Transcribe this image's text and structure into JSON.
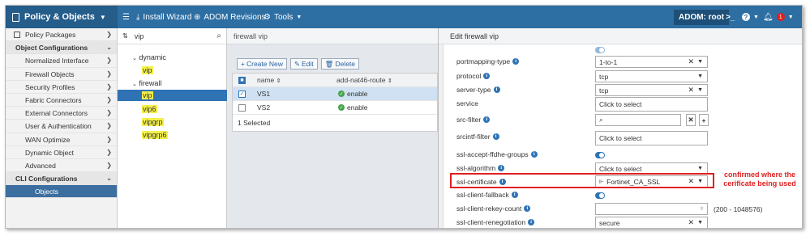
{
  "topbar": {
    "brand": "Policy & Objects",
    "install_wizard": "Install Wizard",
    "adom_revisions": "ADOM Revisions",
    "tools": "Tools",
    "adom": "ADOM: root",
    "notif_count": "1"
  },
  "sidebar": {
    "items": [
      {
        "label": "Policy Packages",
        "type": "top"
      },
      {
        "label": "Object Configurations",
        "type": "section"
      },
      {
        "label": "Normalized Interface",
        "type": "item"
      },
      {
        "label": "Firewall Objects",
        "type": "item"
      },
      {
        "label": "Security Profiles",
        "type": "item"
      },
      {
        "label": "Fabric Connectors",
        "type": "item"
      },
      {
        "label": "External Connectors",
        "type": "item"
      },
      {
        "label": "User & Authentication",
        "type": "item"
      },
      {
        "label": "WAN Optimize",
        "type": "item"
      },
      {
        "label": "Dynamic Object",
        "type": "item"
      },
      {
        "label": "Advanced",
        "type": "item"
      },
      {
        "label": "CLI Configurations",
        "type": "section"
      },
      {
        "label": "Objects",
        "type": "active"
      }
    ]
  },
  "tree": {
    "search_value": "vip",
    "group1": "dynamic",
    "group1_item": "vip",
    "group2": "firewall",
    "items": [
      "vip",
      "vip6",
      "vipgrp",
      "vipgrp6"
    ]
  },
  "list": {
    "title": "firewall vip",
    "create_new": "Create New",
    "edit": "Edit",
    "delete": "Delete",
    "col_name": "name",
    "col_route": "add-nat46-route",
    "rows": [
      {
        "name": "VS1",
        "route": "enable",
        "checked": true
      },
      {
        "name": "VS2",
        "route": "enable",
        "checked": false
      }
    ],
    "footer": "1 Selected"
  },
  "edit": {
    "title": "Edit firewall vip",
    "fields": {
      "portmapping_type": {
        "label": "portmapping-type",
        "value": "1-to-1"
      },
      "protocol": {
        "label": "protocol",
        "value": "tcp"
      },
      "server_type": {
        "label": "server-type",
        "value": "tcp"
      },
      "service": {
        "label": "service",
        "value": "Click to select"
      },
      "src_filter": {
        "label": "src-filter"
      },
      "srcintf_filter": {
        "label": "srcintf-filter",
        "value": "Click to select"
      },
      "ssl_accept_ffdhe_groups": {
        "label": "ssl-accept-ffdhe-groups"
      },
      "ssl_algorithm": {
        "label": "ssl-algorithm",
        "value": "Click to select"
      },
      "ssl_certificate": {
        "label": "ssl-certificate",
        "value": "Fortinet_CA_SSL"
      },
      "ssl_client_fallback": {
        "label": "ssl-client-fallback"
      },
      "ssl_client_rekey_count": {
        "label": "ssl-client-rekey-count",
        "range": "(200 - 1048576)"
      },
      "ssl_client_renegotiation": {
        "label": "ssl-client-renegotiation",
        "value": "secure"
      }
    }
  },
  "annotation": "confirmed where the cerificate being used",
  "colors": {
    "topbar": "#2d6ea3",
    "accent": "#2f73b5",
    "annotation": "#e02020",
    "highlight": "#f4f04a"
  }
}
